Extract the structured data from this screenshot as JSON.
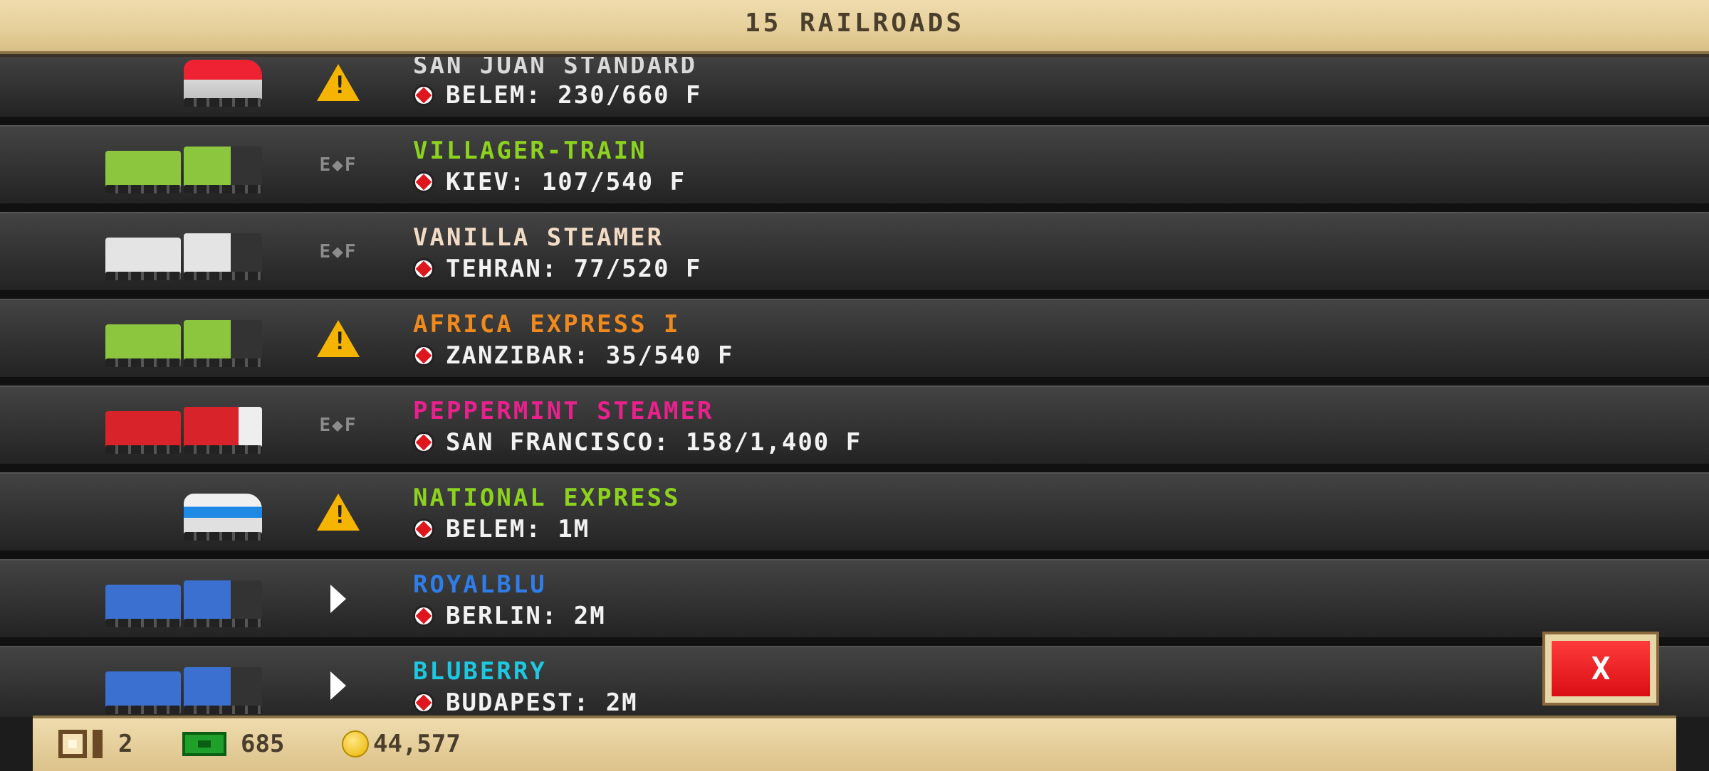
{
  "header": {
    "title": "15 RAILROADS"
  },
  "trains": [
    {
      "name": "SAN JUAN STANDARD",
      "name_color": "#d9d9d9",
      "destination": "BELEM: 230/660 F",
      "status_icon": "warning-icon",
      "train_style": "diesel-red"
    },
    {
      "name": "VILLAGER-TRAIN",
      "name_color": "#8cd21e",
      "destination": "KIEV: 107/540 F",
      "status_icon": "ef",
      "status_text": "E◆F",
      "train_style": "steam-green"
    },
    {
      "name": "VANILLA STEAMER",
      "name_color": "#f2dcc6",
      "destination": "TEHRAN: 77/520 F",
      "status_icon": "ef",
      "status_text": "E◆F",
      "train_style": "steam-white"
    },
    {
      "name": "AFRICA EXPRESS I",
      "name_color": "#f08a1e",
      "destination": "ZANZIBAR: 35/540 F",
      "status_icon": "warning-icon",
      "train_style": "steam-green"
    },
    {
      "name": "PEPPERMINT STEAMER",
      "name_color": "#e8218c",
      "destination": "SAN FRANCISCO: 158/1,400 F",
      "status_icon": "ef",
      "status_text": "E◆F",
      "train_style": "steam-red"
    },
    {
      "name": "NATIONAL EXPRESS",
      "name_color": "#8cd21e",
      "destination": "BELEM: 1M",
      "status_icon": "warning-icon",
      "train_style": "diesel-white"
    },
    {
      "name": "ROYALBLU",
      "name_color": "#2f7de8",
      "destination": "BERLIN: 2M",
      "status_icon": "play-icon",
      "train_style": "steam-blue"
    },
    {
      "name": "BLUBERRY",
      "name_color": "#1ec8e0",
      "destination": "BUDAPEST: 2M",
      "status_icon": "play-icon",
      "train_style": "steam-blue"
    }
  ],
  "close_button": {
    "label": "X"
  },
  "footer": {
    "crates": "2",
    "cash": "685",
    "coins": "44,577"
  }
}
